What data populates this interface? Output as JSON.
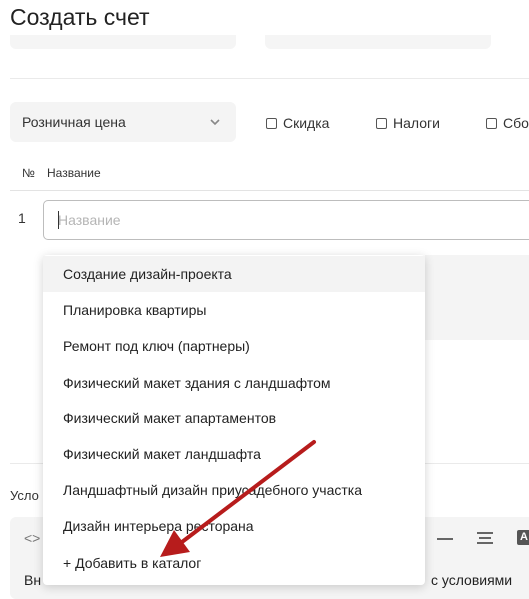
{
  "page": {
    "title": "Создать счет"
  },
  "price": {
    "selected": "Розничная цена"
  },
  "checkboxes": [
    {
      "label": "Скидка",
      "checked": false
    },
    {
      "label": "Налоги",
      "checked": false
    },
    {
      "label": "Сбо",
      "checked": false
    }
  ],
  "table": {
    "headers": {
      "num": "№",
      "name": "Название"
    },
    "row": {
      "num": "1",
      "name_placeholder": "Название",
      "name_value": ""
    }
  },
  "dropdown": {
    "items": [
      "Создание дизайн-проекта",
      "Планировка квартиры",
      "Ремонт под ключ (партнеры)",
      "Физический макет здания с ландшафтом",
      "Физический макет апартаментов",
      "Физический макет ландшафта",
      "Ландшафтный дизайн приусадебного участка",
      "Дизайн интерьера ресторана"
    ],
    "add_label": "+ Добавить в каталог"
  },
  "conditions": {
    "label": "Усло",
    "editor_left_text": "Вн",
    "editor_right_text": "с условиями"
  },
  "colors": {
    "annotation_arrow": "#b71c1c",
    "hover_bg": "#f3f3f3"
  }
}
